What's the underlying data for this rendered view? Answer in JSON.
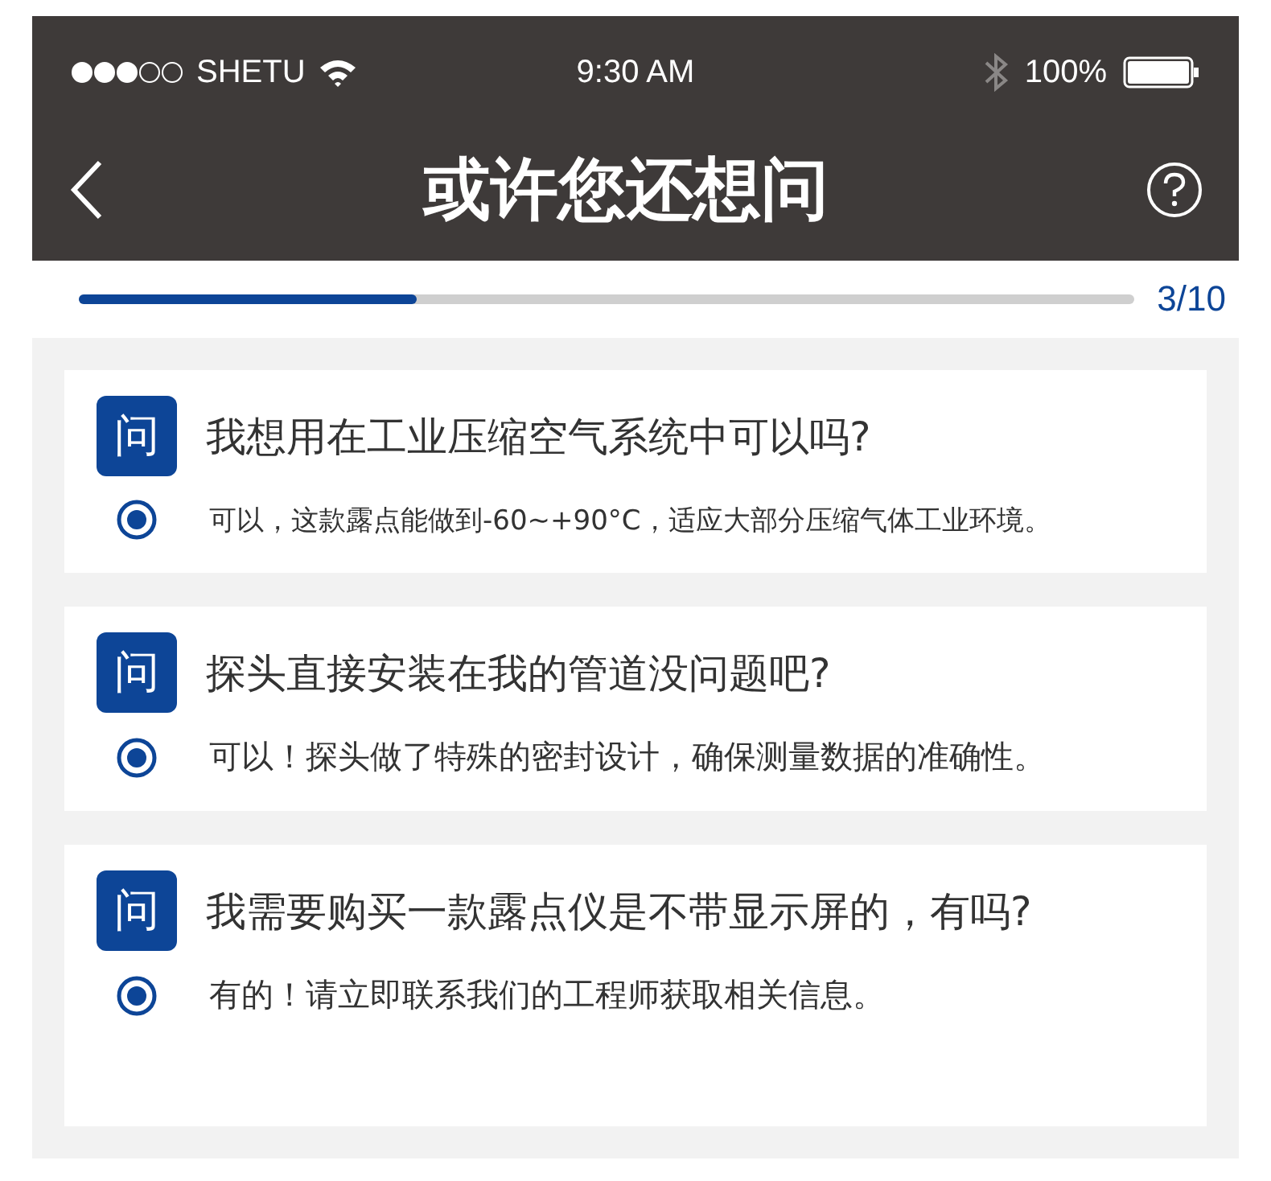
{
  "status_bar": {
    "carrier": "SHETU",
    "time": "9:30 AM",
    "battery": "100%"
  },
  "nav": {
    "title": "或许您还想问"
  },
  "progress": {
    "level": 0.32,
    "reading": "3/10"
  },
  "items": [
    {
      "badge": "问",
      "question": "我想用在工业压缩空气系统中可以吗?",
      "answer": "可以，这款露点能做到-60~+90°C，适应大部分压缩气体工业环境。"
    },
    {
      "badge": "问",
      "question": "探头直接安装在我的管道没问题吧?",
      "answer": "可以！探头做了特殊的密封设计，确保测量数据的准确性。"
    },
    {
      "badge": "问",
      "question": "我需要购买一款露点仪是不带显示屏的，有吗?",
      "answer": "有的！请立即联系我们的工程师获取相关信息。"
    }
  ]
}
